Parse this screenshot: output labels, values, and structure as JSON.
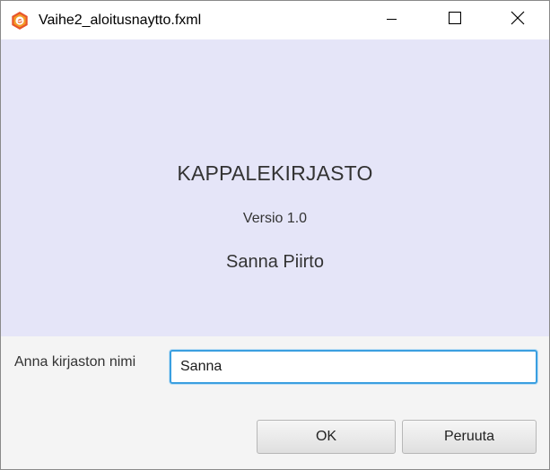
{
  "window": {
    "title": "Vaihe2_aloitusnaytto.fxml",
    "icon": "app-icon",
    "controls": [
      "minimize-icon",
      "maximize-icon",
      "close-icon"
    ]
  },
  "header": {
    "app_title": "KAPPALEKIRJASTO",
    "version": "Versio 1.0",
    "author": "Sanna Piirto",
    "background": "#e5e5f8"
  },
  "form": {
    "name_label": "Anna kirjaston nimi",
    "name_value": "Sanna",
    "focus_color": "#3a9fe0"
  },
  "buttons": {
    "ok_label": "OK",
    "cancel_label": "Peruuta"
  }
}
